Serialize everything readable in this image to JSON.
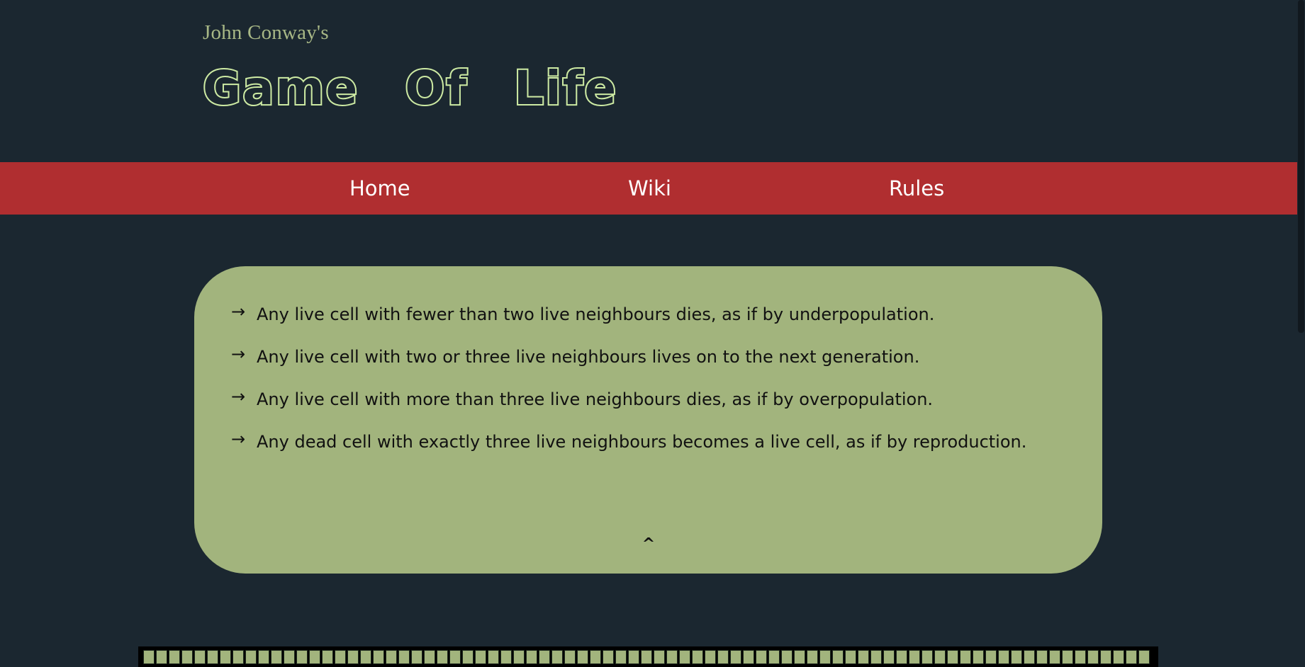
{
  "header": {
    "subtitle": "John Conway's",
    "title": "Game Of Life"
  },
  "nav": {
    "items": [
      {
        "label": "Home"
      },
      {
        "label": "Wiki"
      },
      {
        "label": "Rules"
      }
    ]
  },
  "rules": {
    "items": [
      {
        "arrow": "→",
        "text": "Any live cell with fewer than two live neighbours dies, as if by underpopulation."
      },
      {
        "arrow": "→",
        "text": "Any live cell with two or three live neighbours lives on to the next generation."
      },
      {
        "arrow": "→",
        "text": "Any live cell with more than three live neighbours dies, as if by overpopulation."
      },
      {
        "arrow": "→",
        "text": "Any dead cell with exactly three live neighbours becomes a live cell, as if by reproduction."
      }
    ],
    "collapse_icon": "chevron-up-icon",
    "collapse_glyph": "^"
  },
  "grid": {
    "cell_state": "dead"
  },
  "colors": {
    "background": "#1b2730",
    "accent_red": "#b02e30",
    "card_green": "#a2b47d",
    "title_green": "#cdeaa3",
    "subtitle_green": "#a8b886"
  }
}
